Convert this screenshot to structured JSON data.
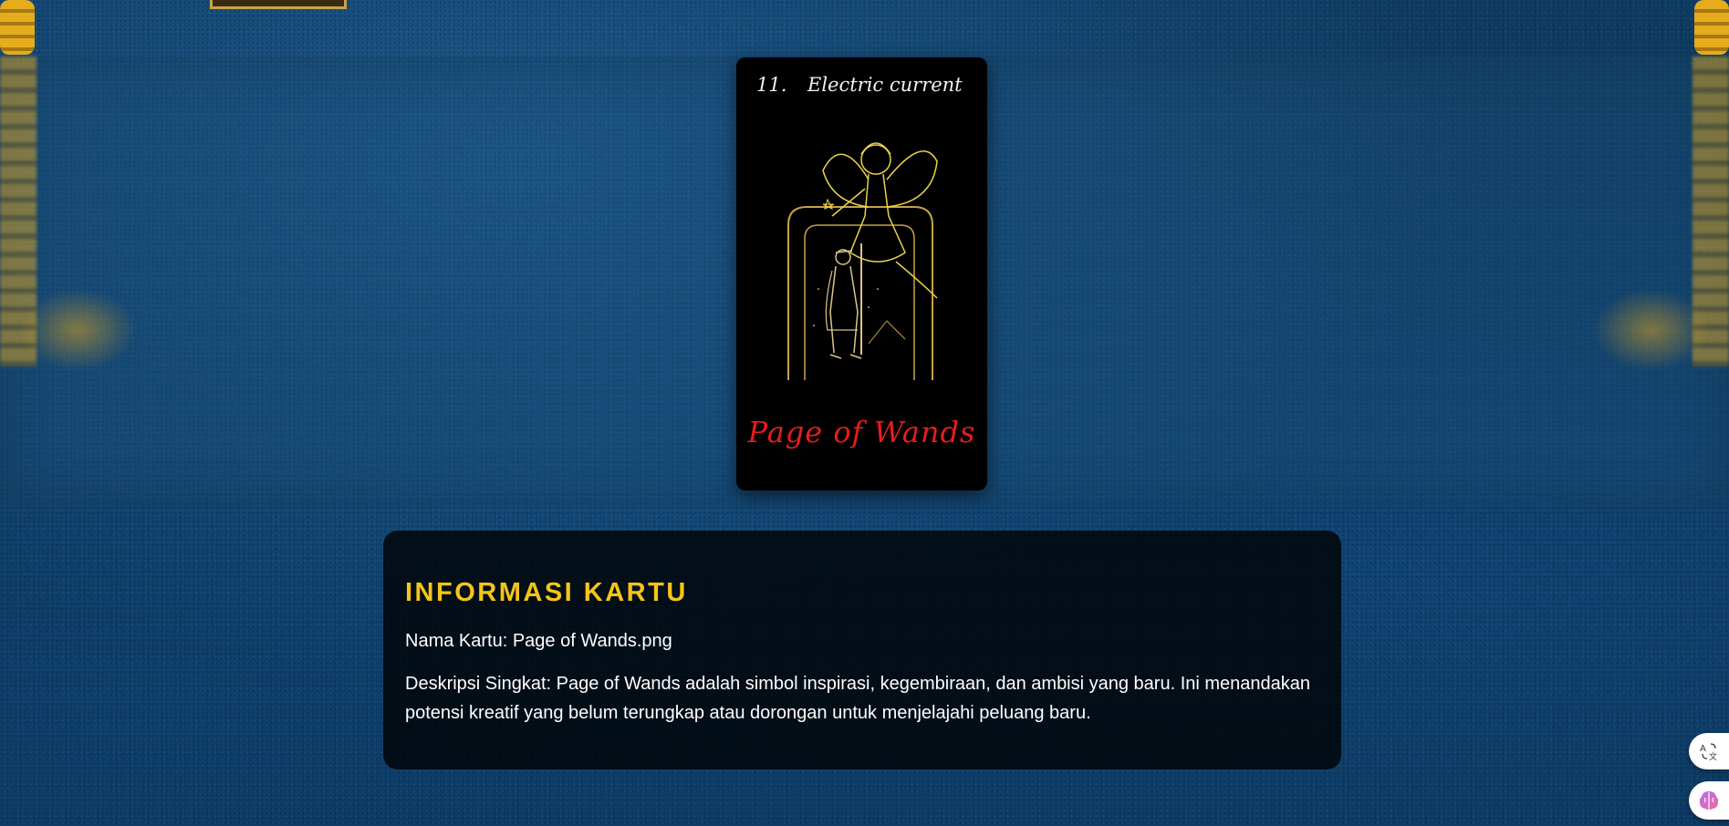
{
  "card": {
    "number": "11.",
    "subtitle": "Electric current",
    "name": "Page of Wands"
  },
  "info": {
    "title": "INFORMASI KARTU",
    "name_line": "Nama Kartu: Page of Wands.png",
    "description_line": "Deskripsi Singkat: Page of Wands adalah simbol inspirasi, kegembiraan, dan ambisi yang baru. Ini menandakan potensi kreatif yang belum terungkap atau dorongan untuk menjelajahi peluang baru."
  },
  "floating_buttons": {
    "translate_icon": "translate-icon",
    "brain_icon": "brain-icon"
  },
  "colors": {
    "accent_gold": "#f5c518",
    "card_name_red": "#e61d1d",
    "background_blue": "#0f3c63"
  }
}
